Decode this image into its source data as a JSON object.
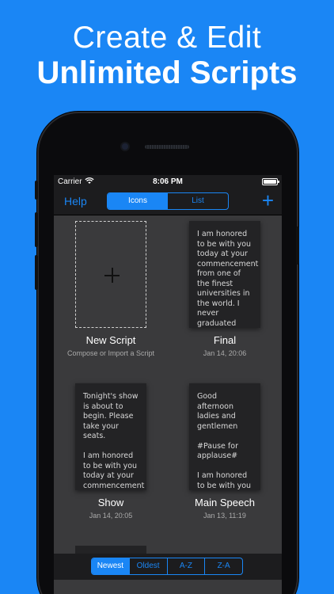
{
  "promo": {
    "line1": "Create & Edit",
    "line2": "Unlimited Scripts"
  },
  "statusbar": {
    "carrier": "Carrier",
    "time": "8:06 PM"
  },
  "navbar": {
    "help": "Help",
    "view_modes": [
      "Icons",
      "List"
    ],
    "active_view": "Icons",
    "add": "+"
  },
  "scripts": [
    {
      "title": "New Script",
      "subtitle": "Compose or Import a Script",
      "preview": ""
    },
    {
      "title": "Final",
      "subtitle": "Jan 14, 20:06",
      "preview": "I am honored to be with you today at your commencement from one of the finest universities in the world. I never graduated fro..."
    },
    {
      "title": "Show",
      "subtitle": "Jan 14, 20:05",
      "preview": "Tonight's show is about to begin. Please take your seats.\n\nI am honored to be with you today at your commencement from one of th..."
    },
    {
      "title": "Main Speech",
      "subtitle": "Jan 13, 11:19",
      "preview": "Good afternoon ladies and gentlemen\n\n#Pause for applause#\n\nI am honored to be with you today at your..."
    }
  ],
  "sort": {
    "options": [
      "Newest",
      "Oldest",
      "A-Z",
      "Z-A"
    ],
    "active": "Newest"
  },
  "colors": {
    "accent": "#1a86f5",
    "background": "#1a86f5",
    "screen": "#3a3a3c",
    "bars": "#1c1c1e"
  }
}
